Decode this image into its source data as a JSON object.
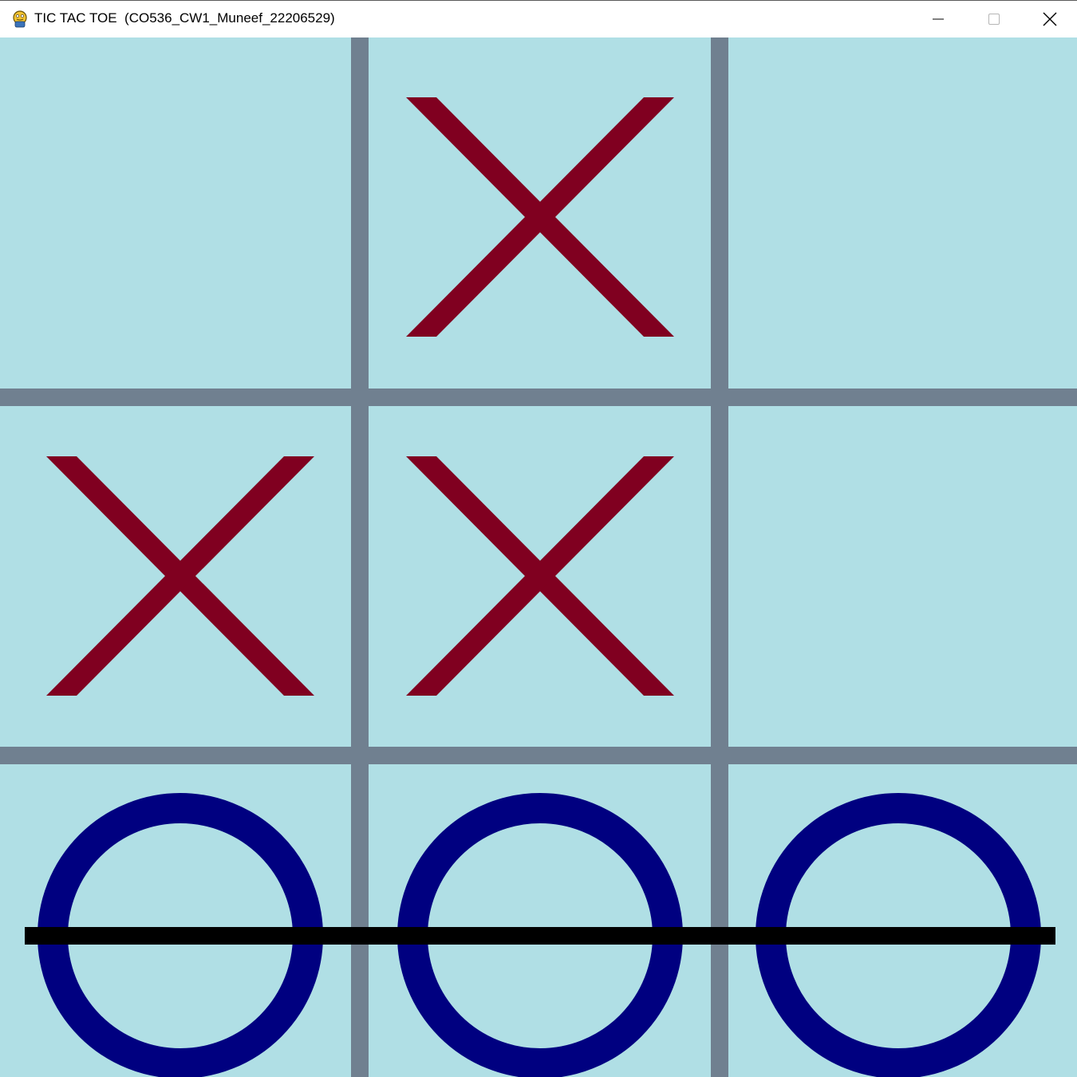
{
  "window": {
    "title": "TIC TAC TOE  (CO536_CW1_Muneef_22206529)",
    "icon": "python-icon",
    "controls": {
      "minimize_icon": "minimize-icon",
      "maximize_icon": "maximize-icon",
      "close_icon": "close-icon"
    }
  },
  "game": {
    "board": [
      [
        "",
        "X",
        ""
      ],
      [
        "X",
        "X",
        ""
      ],
      [
        "O",
        "O",
        "O"
      ]
    ],
    "winning_line": {
      "player": "O",
      "row": 2
    }
  },
  "colors": {
    "background": "#b0dfe5",
    "grid_lines": "#708090",
    "x_mark": "#800020",
    "o_mark": "#000080",
    "win_line": "#000000"
  }
}
